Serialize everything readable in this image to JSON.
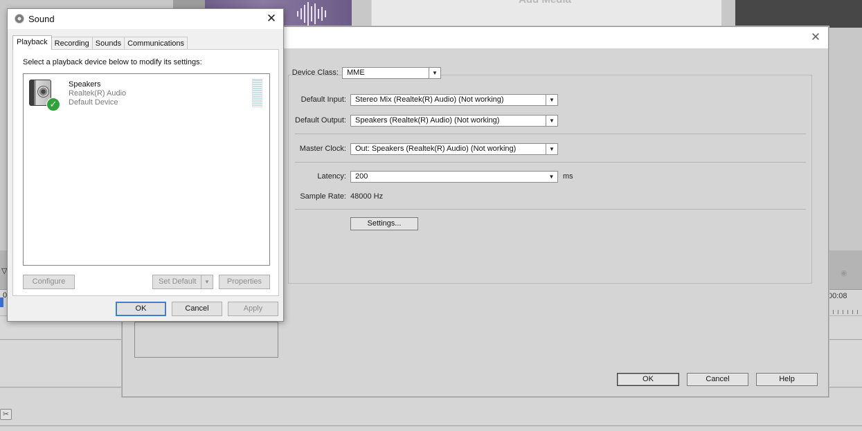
{
  "background_editor": {
    "add_media_label": "Add Media",
    "ruler_label": "00:08",
    "left_ruler_label": "0",
    "triangle_icon": "triangle-down-icon",
    "scissor_icon": "scissor-icon"
  },
  "hardware_dialog": {
    "device_class": {
      "label": "Device Class:",
      "value": "MME"
    },
    "default_input": {
      "label": "Default Input:",
      "value": "Stereo Mix (Realtek(R) Audio) (Not working)"
    },
    "default_output": {
      "label": "Default Output:",
      "value": "Speakers (Realtek(R) Audio) (Not working)"
    },
    "master_clock": {
      "label": "Master Clock:",
      "value": "Out: Speakers (Realtek(R) Audio) (Not working)"
    },
    "latency": {
      "label": "Latency:",
      "value": "200",
      "unit": "ms"
    },
    "sample_rate": {
      "label": "Sample Rate:",
      "value": "48000 Hz"
    },
    "settings_button": "Settings...",
    "ok_button": "OK",
    "cancel_button": "Cancel",
    "help_button": "Help",
    "close_glyph": "✕"
  },
  "sound_dialog": {
    "title": "Sound",
    "close_glyph": "✕",
    "tabs": [
      {
        "label": "Playback",
        "active": true
      },
      {
        "label": "Recording",
        "active": false
      },
      {
        "label": "Sounds",
        "active": false
      },
      {
        "label": "Communications",
        "active": false
      }
    ],
    "instruction": "Select a playback device below to modify its settings:",
    "devices": [
      {
        "name": "Speakers",
        "driver": "Realtek(R) Audio",
        "status": "Default Device",
        "icon": "speaker-icon",
        "badge": "default-check-icon"
      }
    ],
    "buttons": {
      "configure": "Configure",
      "set_default": "Set Default",
      "properties": "Properties",
      "ok": "OK",
      "cancel": "Cancel",
      "apply": "Apply"
    }
  }
}
